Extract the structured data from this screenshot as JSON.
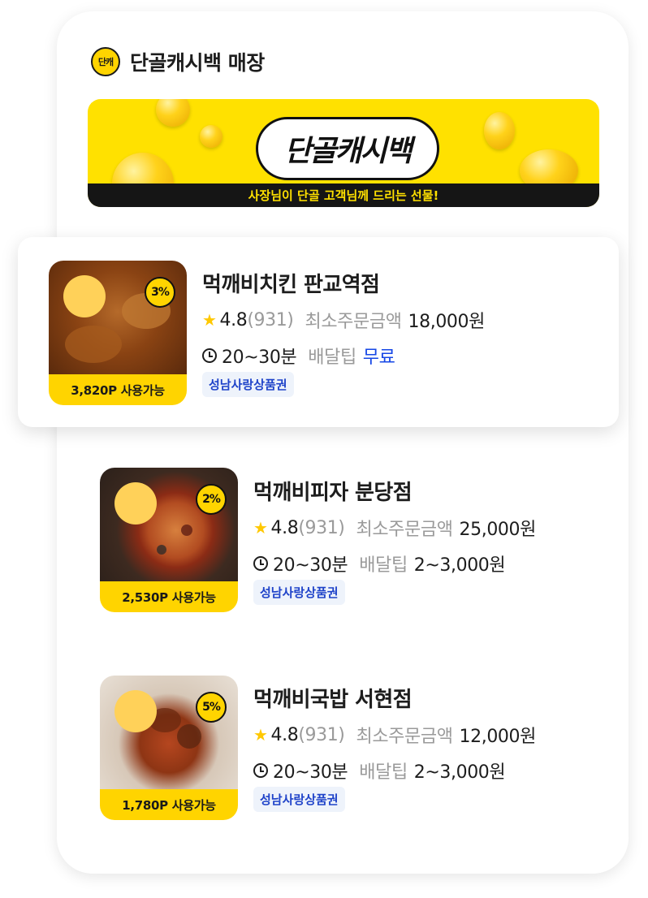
{
  "section": {
    "badge": "단캐",
    "title": "단골캐시백 매장"
  },
  "banner": {
    "logo": "단골캐시백",
    "strip": "사장님이 단골 고객님께 드리는 선물!"
  },
  "stores": [
    {
      "name": "먹깨비치킨 판교역점",
      "percent": "3%",
      "points": "3,820P 사용가능",
      "rating": "4.8",
      "reviews": "(931)",
      "min_label": "최소주문금액",
      "min_value": "18,000원",
      "time": "20~30분",
      "tip_label": "배달팁",
      "tip_value": "무료",
      "tag": "성남사랑상품권",
      "accent": "#1446e6"
    },
    {
      "name": "먹깨비피자 분당점",
      "percent": "2%",
      "points": "2,530P 사용가능",
      "rating": "4.8",
      "reviews": "(931)",
      "min_label": "최소주문금액",
      "min_value": "25,000원",
      "time": "20~30분",
      "tip_label": "배달팁",
      "tip_value": "2~3,000원",
      "tag": "성남사랑상품권"
    },
    {
      "name": "먹깨비국밥 서현점",
      "percent": "5%",
      "points": "1,780P 사용가능",
      "rating": "4.8",
      "reviews": "(931)",
      "min_label": "최소주문금액",
      "min_value": "12,000원",
      "time": "20~30분",
      "tip_label": "배달팁",
      "tip_value": "2~3,000원",
      "tag": "성남사랑상품권"
    }
  ],
  "colors": {
    "brand_yellow": "#ffd400",
    "banner_yellow": "#ffe100",
    "tag_blue": "#1f43c9",
    "tag_bg": "#eef3fb"
  },
  "icons": {
    "star": "star-icon",
    "clock": "clock-icon",
    "section_logo": "cashback-logo-icon"
  }
}
